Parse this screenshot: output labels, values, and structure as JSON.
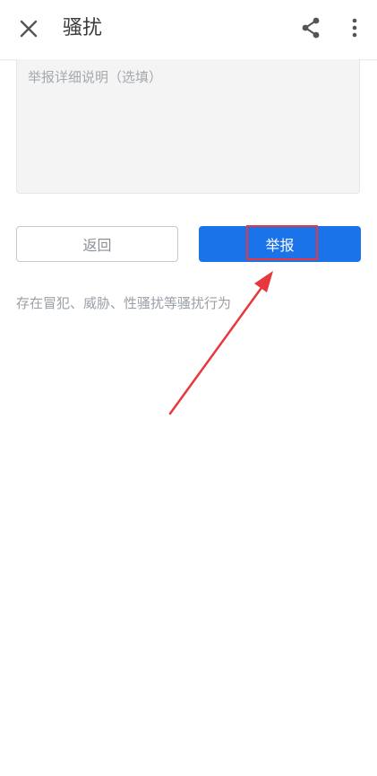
{
  "header": {
    "title": "骚扰",
    "close_icon": "close-icon",
    "share_icon": "share-icon",
    "more_icon": "more-vert-icon"
  },
  "form": {
    "details_placeholder": "举报详细说明（选填）",
    "back_label": "返回",
    "report_label": "举报"
  },
  "category_description": "存在冒犯、威胁、性骚扰等骚扰行为",
  "annotation": {
    "highlight_color": "#e8383d",
    "arrow_color": "#e8383d"
  },
  "colors": {
    "primary": "#1a73e8",
    "placeholder": "#a4a9ae",
    "description": "#9aa0a6"
  }
}
